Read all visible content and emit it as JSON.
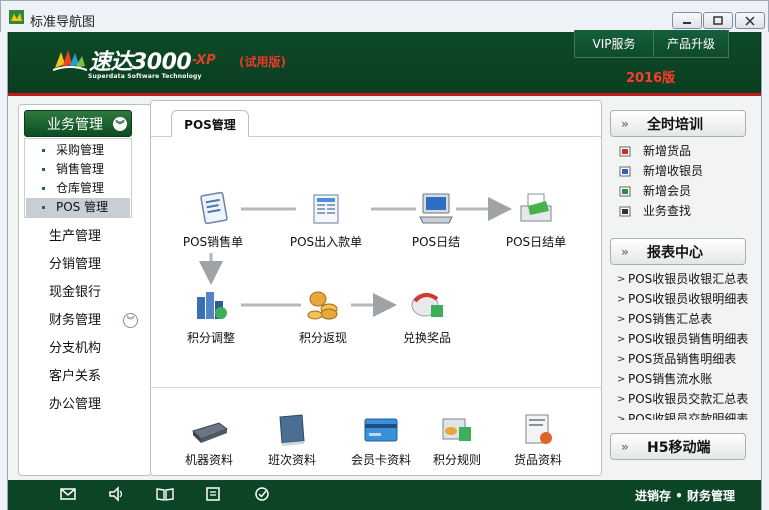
{
  "window": {
    "title": "标准导航图",
    "controls": [
      "minimize-icon",
      "restore-icon",
      "close-icon"
    ]
  },
  "header": {
    "brand": "速达3000",
    "brand_suffix": "-XP",
    "trial": "(试用版)",
    "brand_subtitle": "Superdata Software Technology",
    "vip_label": "VIP服务",
    "upgrade_label": "产品升级",
    "year": "2016版",
    "accent": "#c21a1a",
    "banner_color": "#0d4a27"
  },
  "sidebar": {
    "active_category": "业务管理",
    "sub_items": [
      {
        "label": "采购管理",
        "selected": false
      },
      {
        "label": "销售管理",
        "selected": false
      },
      {
        "label": "仓库管理",
        "selected": false
      },
      {
        "label": "POS 管理",
        "selected": true
      }
    ],
    "items": [
      {
        "label": "生产管理"
      },
      {
        "label": "分销管理"
      },
      {
        "label": "现金银行"
      },
      {
        "label": "财务管理"
      },
      {
        "label": "分支机构"
      },
      {
        "label": "客户关系"
      },
      {
        "label": "办公管理"
      }
    ]
  },
  "main": {
    "tab": "POS管理",
    "flow": [
      {
        "label": "POS销售单",
        "icon": "sales-doc-icon"
      },
      {
        "label": "POS出入款单",
        "icon": "cash-doc-icon"
      },
      {
        "label": "POS日结",
        "icon": "computer-icon"
      },
      {
        "label": "POS日结单",
        "icon": "printer-icon"
      },
      {
        "label": "积分调整",
        "icon": "points-adjust-icon"
      },
      {
        "label": "积分返现",
        "icon": "coins-icon"
      },
      {
        "label": "兑换奖品",
        "icon": "exchange-icon"
      }
    ],
    "bottom_items": [
      {
        "label": "机器资料",
        "icon": "machine-icon"
      },
      {
        "label": "班次资料",
        "icon": "shift-book-icon"
      },
      {
        "label": "会员卡资料",
        "icon": "member-card-icon"
      },
      {
        "label": "积分规则",
        "icon": "rules-icon"
      },
      {
        "label": "货品资料",
        "icon": "goods-icon"
      }
    ]
  },
  "right": {
    "training": {
      "title": "全时培训",
      "items": [
        "新增货品",
        "新增收银员",
        "新增会员",
        "业务查找"
      ]
    },
    "reports": {
      "title": "报表中心",
      "items": [
        "POS收银员收银汇总表",
        "POS收银员收银明细表",
        "POS销售汇总表",
        "POS收银员销售明细表",
        "POS货品销售明细表",
        "POS销售流水账",
        "POS收银员交款汇总表",
        "POS收银员交款明细表"
      ]
    },
    "mobile": {
      "title": "H5移动端"
    }
  },
  "footer": {
    "icons": [
      "mail-icon",
      "sound-icon",
      "book-icon",
      "list-icon",
      "check-icon"
    ],
    "text": "进销存 • 财务管理"
  }
}
